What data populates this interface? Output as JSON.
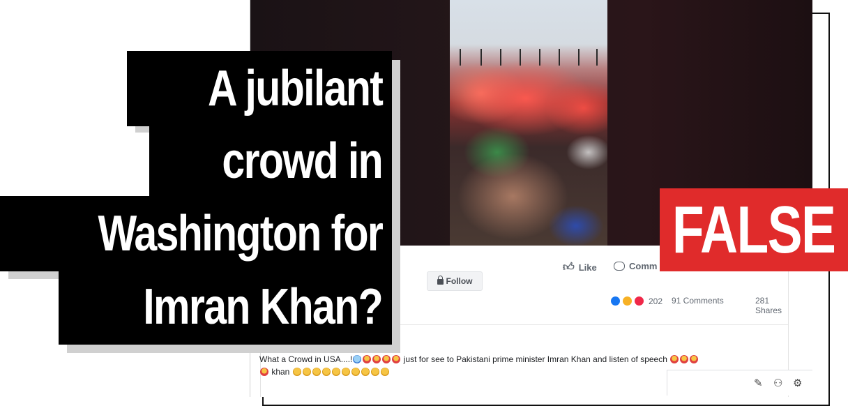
{
  "headline": {
    "lines": [
      "A jubilant",
      "crowd in",
      "Washington for",
      "Imran Khan?"
    ]
  },
  "verdict": {
    "label": "FALSE",
    "color": "#e02b2b"
  },
  "post": {
    "follow_label": "Follow",
    "follow_icon": "lock-icon",
    "like_label": "Like",
    "like_icon": "thumbs-up-icon",
    "comment_label": "Comm",
    "comment_icon": "comment-bubble-icon",
    "reaction_count": "202",
    "comments_count": "91 Comments",
    "shares_count": "281 Shares",
    "text_part1": "What a Crowd in USA....!",
    "text_part2": " just for see to Pakistani prime minister Imran Khan and listen of speech ",
    "text_part3": " khan ",
    "toolbar_icons": [
      "edit-icon",
      "people-icon",
      "gear-icon"
    ]
  }
}
